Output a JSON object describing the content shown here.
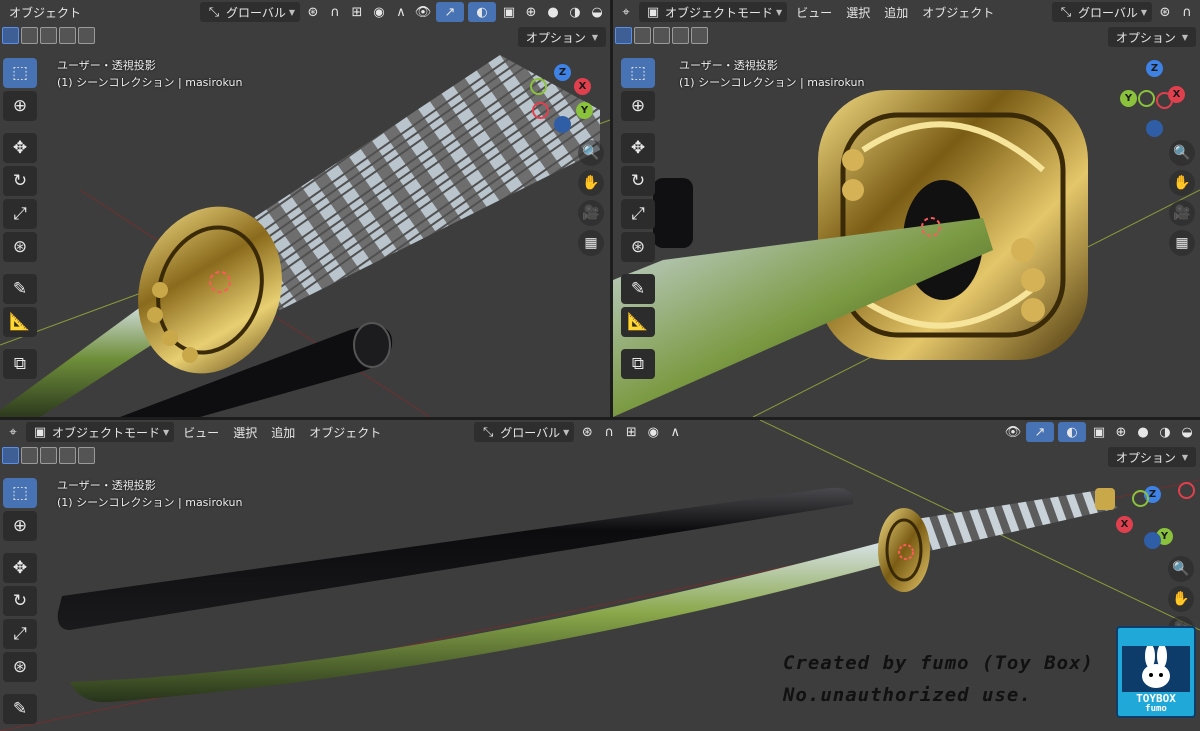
{
  "viewports": {
    "top_left": {
      "header": {
        "mode_label": "オブジェクト",
        "transform_orientation": "グローバル"
      },
      "options_label": "オプション",
      "view_name": "ユーザー・透視投影",
      "collection_info": "(1) シーンコレクション | masirokun"
    },
    "top_right": {
      "header": {
        "mode_label": "オブジェクトモード",
        "menu": [
          "ビュー",
          "選択",
          "追加",
          "オブジェクト"
        ],
        "transform_orientation": "グローバル"
      },
      "options_label": "オプション",
      "view_name": "ユーザー・透視投影",
      "collection_info": "(1) シーンコレクション | masirokun"
    },
    "bottom": {
      "header": {
        "mode_label": "オブジェクトモード",
        "menu": [
          "ビュー",
          "選択",
          "追加",
          "オブジェクト"
        ],
        "transform_orientation": "グローバル"
      },
      "options_label": "オプション",
      "view_name": "ユーザー・透視投影",
      "collection_info": "(1) シーンコレクション | masirokun"
    }
  },
  "gizmo_axes": {
    "x": "X",
    "y": "Y",
    "z": "Z"
  },
  "axis_colors": {
    "x": "#e0404e",
    "y": "#8ac23c",
    "z": "#3f82e6"
  },
  "accent_color": "#4772b3",
  "toolbar_icons": [
    "select-box-icon",
    "cursor-icon",
    "move-icon",
    "rotate-icon",
    "scale-icon",
    "transform-icon",
    "annotate-icon",
    "measure-icon",
    "add-cube-icon"
  ],
  "nav_icons": [
    "zoom-icon",
    "hand-icon",
    "camera-icon",
    "grid-icon"
  ],
  "credit": {
    "line1": "Created by fumo (Toy Box)",
    "line2": "No.unauthorized use."
  },
  "logo": {
    "line1": "TOYBOX",
    "line2": "fumo"
  }
}
